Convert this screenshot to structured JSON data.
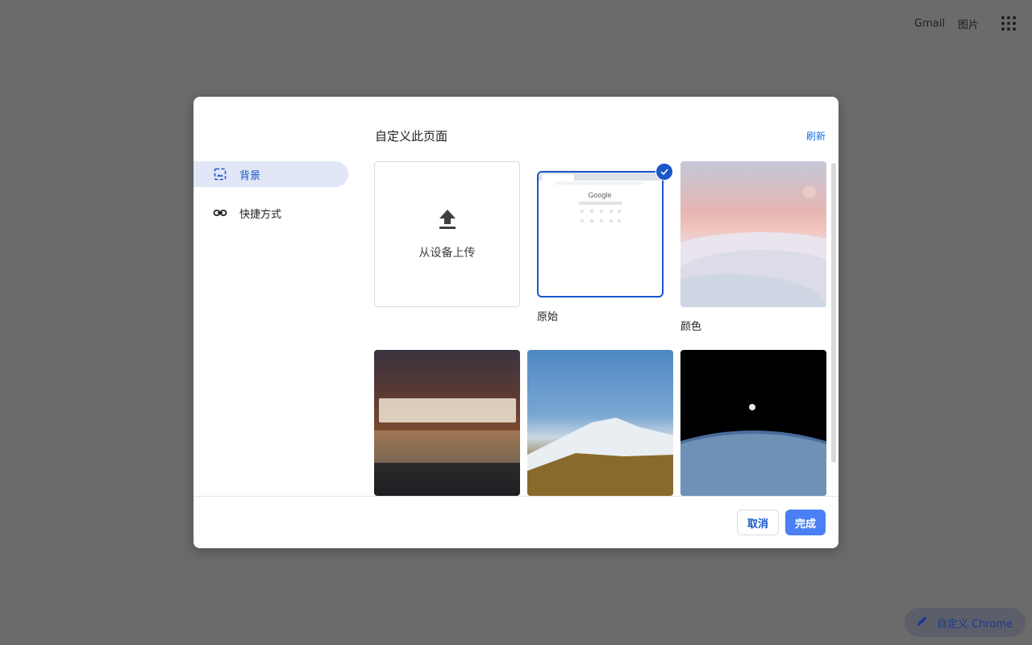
{
  "topbar": {
    "gmail": "Gmail",
    "images": "图片",
    "apps_icon": "apps-grid-icon"
  },
  "dialog": {
    "title": "自定义此页面",
    "refresh": "刷新",
    "nav": [
      {
        "label": "背景",
        "icon": "wallpaper-icon",
        "active": true
      },
      {
        "label": "快捷方式",
        "icon": "link-icon",
        "active": false
      }
    ],
    "upload_label": "从设备上传",
    "tiles": {
      "original": "原始",
      "color": "颜色"
    },
    "preview_logo": "Google",
    "cancel": "取消",
    "done": "完成"
  },
  "customize_button": "自定义 Chrome",
  "colors": {
    "accent": "#1a56c9",
    "done_bg": "#4a7ff5",
    "overlay": "#6b6b6b"
  }
}
